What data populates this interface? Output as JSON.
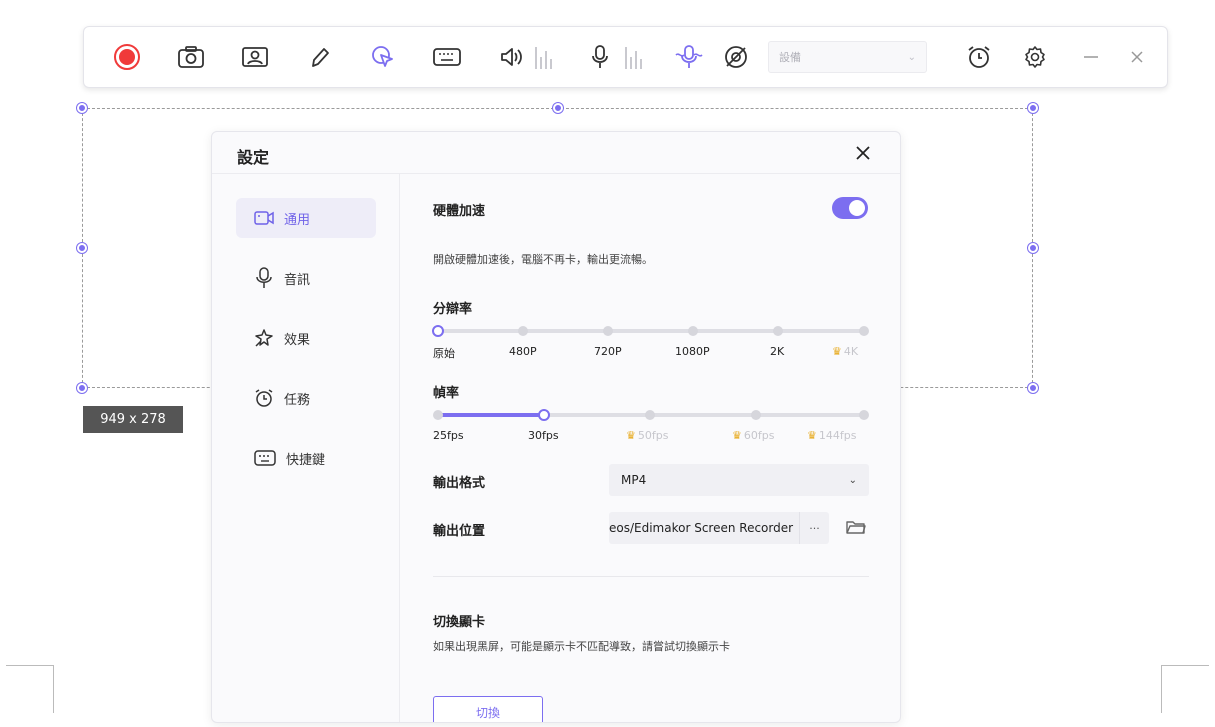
{
  "toolbar": {
    "icons": [
      "record-icon",
      "camera-icon",
      "webcam-icon",
      "pen-icon",
      "cursor-icon",
      "keyboard-icon",
      "speaker-icon",
      "microphone-icon",
      "mic-effect-icon",
      "no-watermark-icon",
      "alarm-icon",
      "gear-icon",
      "minimize-icon",
      "close-icon"
    ],
    "device_placeholder": "設備",
    "record_color": "#f03a3a",
    "accent_color": "#7c6ef0"
  },
  "selection": {
    "size_label": "949 x 278"
  },
  "dialog": {
    "title": "設定",
    "sidebar": [
      {
        "label": "通用",
        "icon": "video-icon",
        "active": true
      },
      {
        "label": "音訊",
        "icon": "microphone-icon",
        "active": false
      },
      {
        "label": "效果",
        "icon": "sparkle-icon",
        "active": false
      },
      {
        "label": "任務",
        "icon": "alarm-icon",
        "active": false
      },
      {
        "label": "快捷鍵",
        "icon": "keyboard-icon",
        "active": false
      }
    ],
    "hardware": {
      "label": "硬體加速",
      "enabled": true,
      "description": "開啟硬體加速後，電腦不再卡，輸出更流暢。"
    },
    "resolution": {
      "label": "分辯率",
      "options": [
        {
          "label": "原始",
          "locked": false
        },
        {
          "label": "480P",
          "locked": false
        },
        {
          "label": "720P",
          "locked": false
        },
        {
          "label": "1080P",
          "locked": false
        },
        {
          "label": "2K",
          "locked": false
        },
        {
          "label": "4K",
          "locked": true
        }
      ],
      "selected_index": 0
    },
    "framerate": {
      "label": "幀率",
      "options": [
        {
          "label": "25fps",
          "locked": false
        },
        {
          "label": "30fps",
          "locked": false
        },
        {
          "label": "50fps",
          "locked": true
        },
        {
          "label": "60fps",
          "locked": true
        },
        {
          "label": "144fps",
          "locked": true
        }
      ],
      "selected_index": 1
    },
    "output_format": {
      "label": "輸出格式",
      "value": "MP4"
    },
    "output_path": {
      "label": "輸出位置",
      "value": "eos/Edimakor Screen Recorder",
      "more": "···"
    },
    "gpu_switch": {
      "label": "切換顯卡",
      "description": "如果出現黑屏，可能是顯示卡不匹配導致，請嘗試切換顯示卡",
      "button": "切換"
    }
  }
}
